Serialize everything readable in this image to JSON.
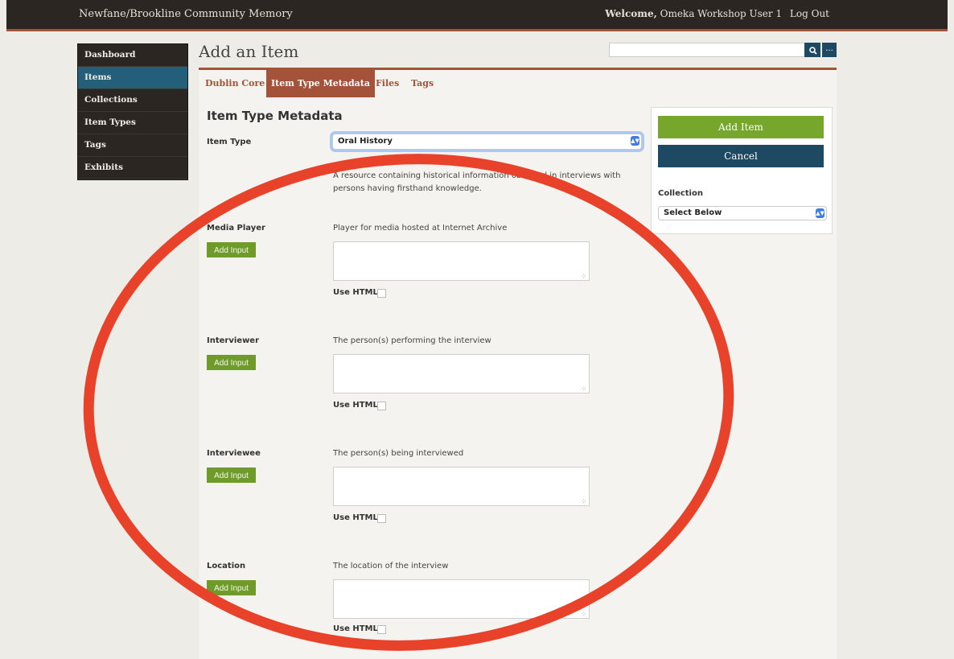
{
  "header": {
    "site_title": "Newfane/Brookline Community Memory",
    "welcome_label": "Welcome,",
    "user_name": "Omeka Workshop User 1",
    "logout": "Log Out"
  },
  "sidebar": {
    "items": [
      {
        "label": "Dashboard"
      },
      {
        "label": "Items",
        "active": true
      },
      {
        "label": "Collections"
      },
      {
        "label": "Item Types"
      },
      {
        "label": "Tags"
      },
      {
        "label": "Exhibits"
      }
    ]
  },
  "page": {
    "title": "Add an Item"
  },
  "search": {
    "placeholder": "",
    "button_icon": "search-icon",
    "advanced_label": "..."
  },
  "tabs": [
    {
      "label": "Dublin Core"
    },
    {
      "label": "Item Type Metadata",
      "active": true
    },
    {
      "label": "Files"
    },
    {
      "label": "Tags"
    }
  ],
  "form": {
    "heading": "Item Type Metadata",
    "item_type_label": "Item Type",
    "item_type_value": "Oral History",
    "item_type_description": "A resource containing historical information obtained in interviews with persons having firsthand knowledge.",
    "use_html_label": "Use HTML",
    "add_input_label": "Add Input",
    "fields": [
      {
        "label": "Media Player",
        "description": "Player for media hosted at Internet Archive",
        "value": ""
      },
      {
        "label": "Interviewer",
        "description": "The person(s) performing the interview",
        "value": ""
      },
      {
        "label": "Interviewee",
        "description": "The person(s) being interviewed",
        "value": ""
      },
      {
        "label": "Location",
        "description": "The location of the interview",
        "value": ""
      }
    ]
  },
  "side": {
    "add_item_label": "Add Item",
    "cancel_label": "Cancel",
    "collection_label": "Collection",
    "collection_value": "Select Below"
  },
  "colors": {
    "accent": "#a4523a",
    "nav_active": "#235e7a",
    "primary_button": "#76a72c",
    "secondary_button": "#1d4963",
    "annotation": "#e8432a"
  }
}
